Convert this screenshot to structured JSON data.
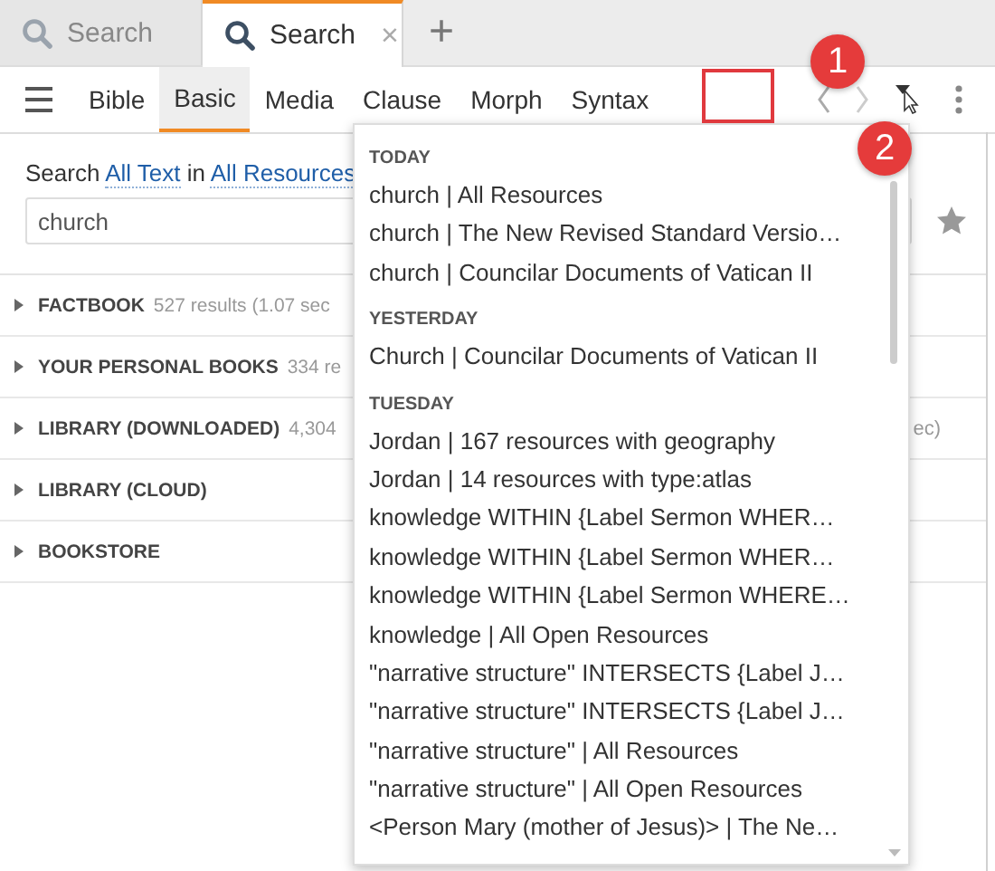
{
  "tabs": [
    {
      "label": "Search",
      "selected": false
    },
    {
      "label": "Search",
      "selected": true,
      "close": "×"
    }
  ],
  "new_tab": "+",
  "modes": [
    {
      "label": "Bible",
      "selected": false
    },
    {
      "label": "Basic",
      "selected": true
    },
    {
      "label": "Media",
      "selected": false
    },
    {
      "label": "Clause",
      "selected": false
    },
    {
      "label": "Morph",
      "selected": false
    },
    {
      "label": "Syntax",
      "selected": false
    }
  ],
  "search_line": [
    {
      "kind": "text",
      "text": "Search "
    },
    {
      "kind": "link",
      "text": "All Text"
    },
    {
      "kind": "text",
      "text": " in "
    },
    {
      "kind": "link",
      "text": "All Resources"
    }
  ],
  "query": {
    "value": "church"
  },
  "sections": [
    {
      "title": "FACTBOOK",
      "count": "527 results (1.07 sec",
      "expanded": false
    },
    {
      "title": "YOUR PERSONAL BOOKS",
      "count": "334 re",
      "expanded": false
    },
    {
      "title": "LIBRARY (DOWNLOADED)",
      "count": "4,304",
      "tail": "ec)",
      "expanded": false
    },
    {
      "title": "LIBRARY (CLOUD)",
      "expanded": false
    },
    {
      "title": "BOOKSTORE",
      "expanded": false
    }
  ],
  "history": [
    {
      "heading": "TODAY",
      "items": [
        "church | All Resources",
        "church | The New Revised Standard Versio…",
        "church | Councilar Documents of Vatican II"
      ]
    },
    {
      "heading": "YESTERDAY",
      "items": [
        "Church | Councilar Documents of Vatican II"
      ]
    },
    {
      "heading": "TUESDAY",
      "items": [
        "Jordan | 167 resources with geography",
        "Jordan | 14 resources with type:atlas",
        "knowledge WITHIN  {Label Sermon WHER…",
        "knowledge WITHIN  {Label Sermon WHER…",
        "knowledge WITHIN {Label Sermon WHERE…",
        "knowledge | All Open Resources",
        "\"narrative structure\" INTERSECTS {Label J…",
        "\"narrative structure\" INTERSECTS {Label J…",
        "\"narrative structure\" | All Resources",
        "\"narrative structure\" | All Open Resources",
        "<Person Mary (mother of Jesus)> | The Ne…"
      ]
    }
  ],
  "annotations": [
    {
      "kind": "box"
    },
    {
      "kind": "badge",
      "label": "1"
    },
    {
      "kind": "badge",
      "label": "2"
    }
  ]
}
